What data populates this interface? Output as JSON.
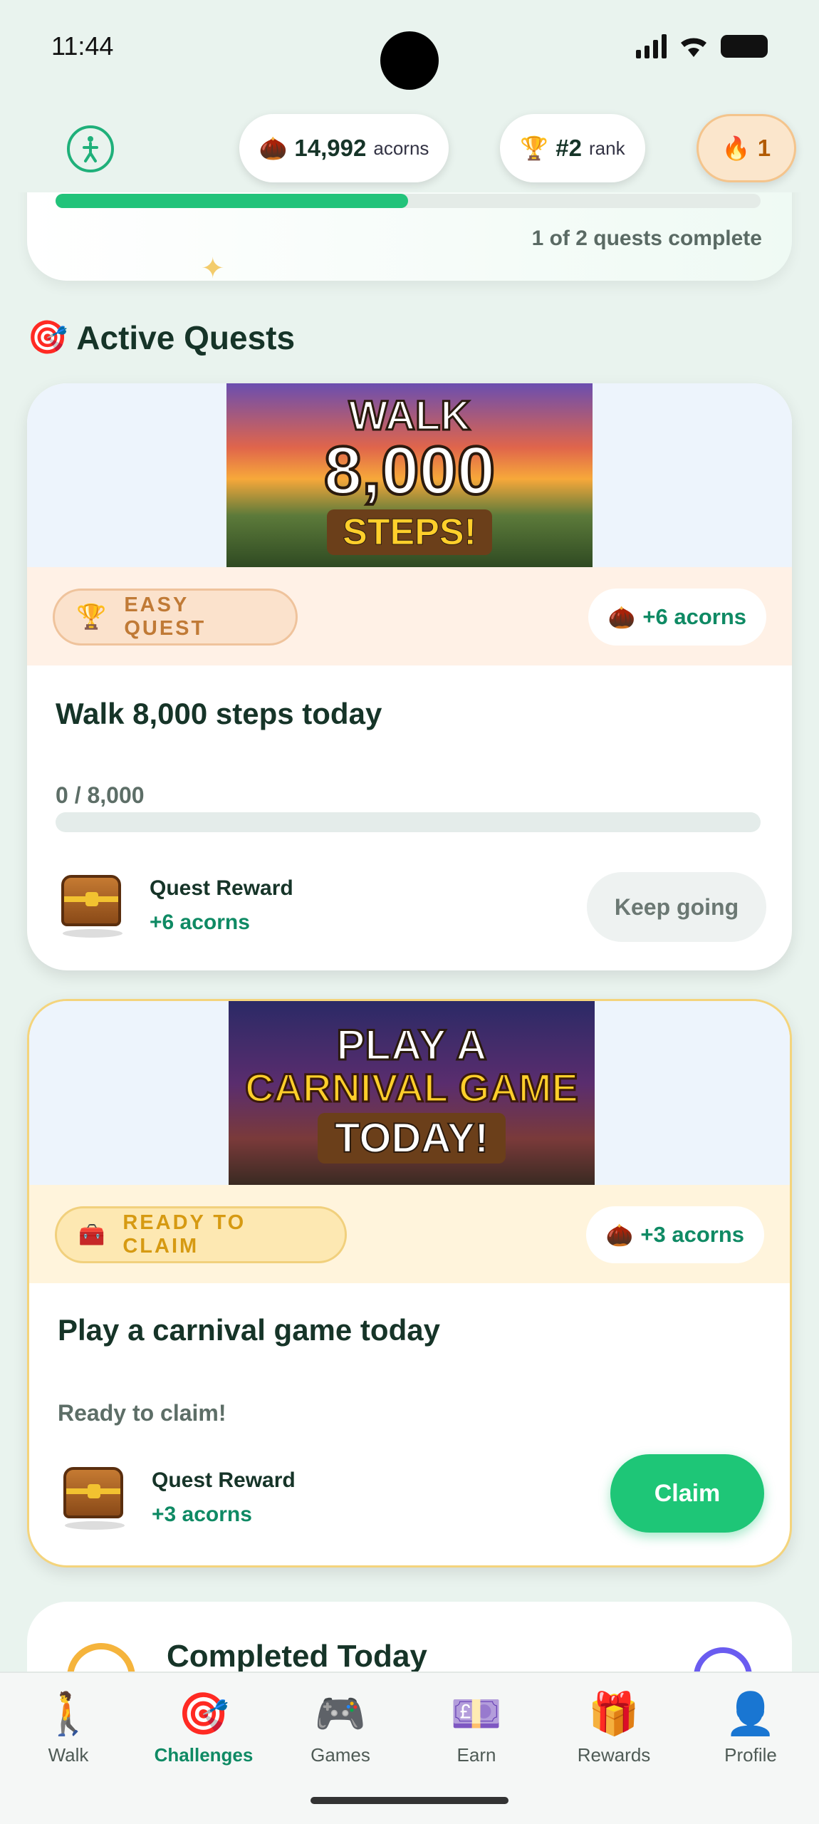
{
  "status_bar": {
    "time": "11:44"
  },
  "header": {
    "acorns_value": "14,992",
    "acorns_unit": "acorns",
    "rank_value": "#2",
    "rank_unit": "rank",
    "streak_value": "1",
    "icons": {
      "walker": "walker-icon",
      "acorn": "acorn-icon",
      "trophy": "trophy-icon",
      "flame": "flame-icon"
    }
  },
  "summary": {
    "progress_text": "1 of 2 quests complete",
    "progress_fraction": 0.5
  },
  "section": {
    "title": "Active Quests",
    "icon": "target-icon"
  },
  "quests": [
    {
      "banner_lines": [
        "WALK",
        "8,000",
        "STEPS!"
      ],
      "tag": "EASY QUEST",
      "tag_icon": "trophy-icon",
      "reward_chip": "+6 acorns",
      "title": "Walk 8,000 steps today",
      "progress_label": "0 / 8,000",
      "progress_fraction": 0,
      "reward_label": "Quest Reward",
      "reward_value": "+6 acorns",
      "button_label": "Keep going"
    },
    {
      "banner_lines": [
        "PLAY A",
        "CARNIVAL GAME",
        "TODAY!"
      ],
      "tag": "READY TO CLAIM",
      "tag_icon": "chest-icon",
      "reward_chip": "+3 acorns",
      "title": "Play a carnival game today",
      "status": "Ready to claim!",
      "reward_label": "Quest Reward",
      "reward_value": "+3 acorns",
      "button_label": "Claim"
    }
  ],
  "completed": {
    "title": "Completed Today"
  },
  "nav": [
    {
      "label": "Walk",
      "icon": "walk-icon",
      "glyph": "🚶"
    },
    {
      "label": "Challenges",
      "icon": "target-icon",
      "glyph": "🎯"
    },
    {
      "label": "Games",
      "icon": "gamepad-icon",
      "glyph": "🎮"
    },
    {
      "label": "Earn",
      "icon": "banknote-icon",
      "glyph": "💷"
    },
    {
      "label": "Rewards",
      "icon": "gift-icon",
      "glyph": "🎁"
    },
    {
      "label": "Profile",
      "icon": "profile-icon",
      "glyph": "👤"
    }
  ],
  "colors": {
    "accent": "#1ec677",
    "reward_text": "#0f8a64",
    "background": "#e9f3ee"
  }
}
